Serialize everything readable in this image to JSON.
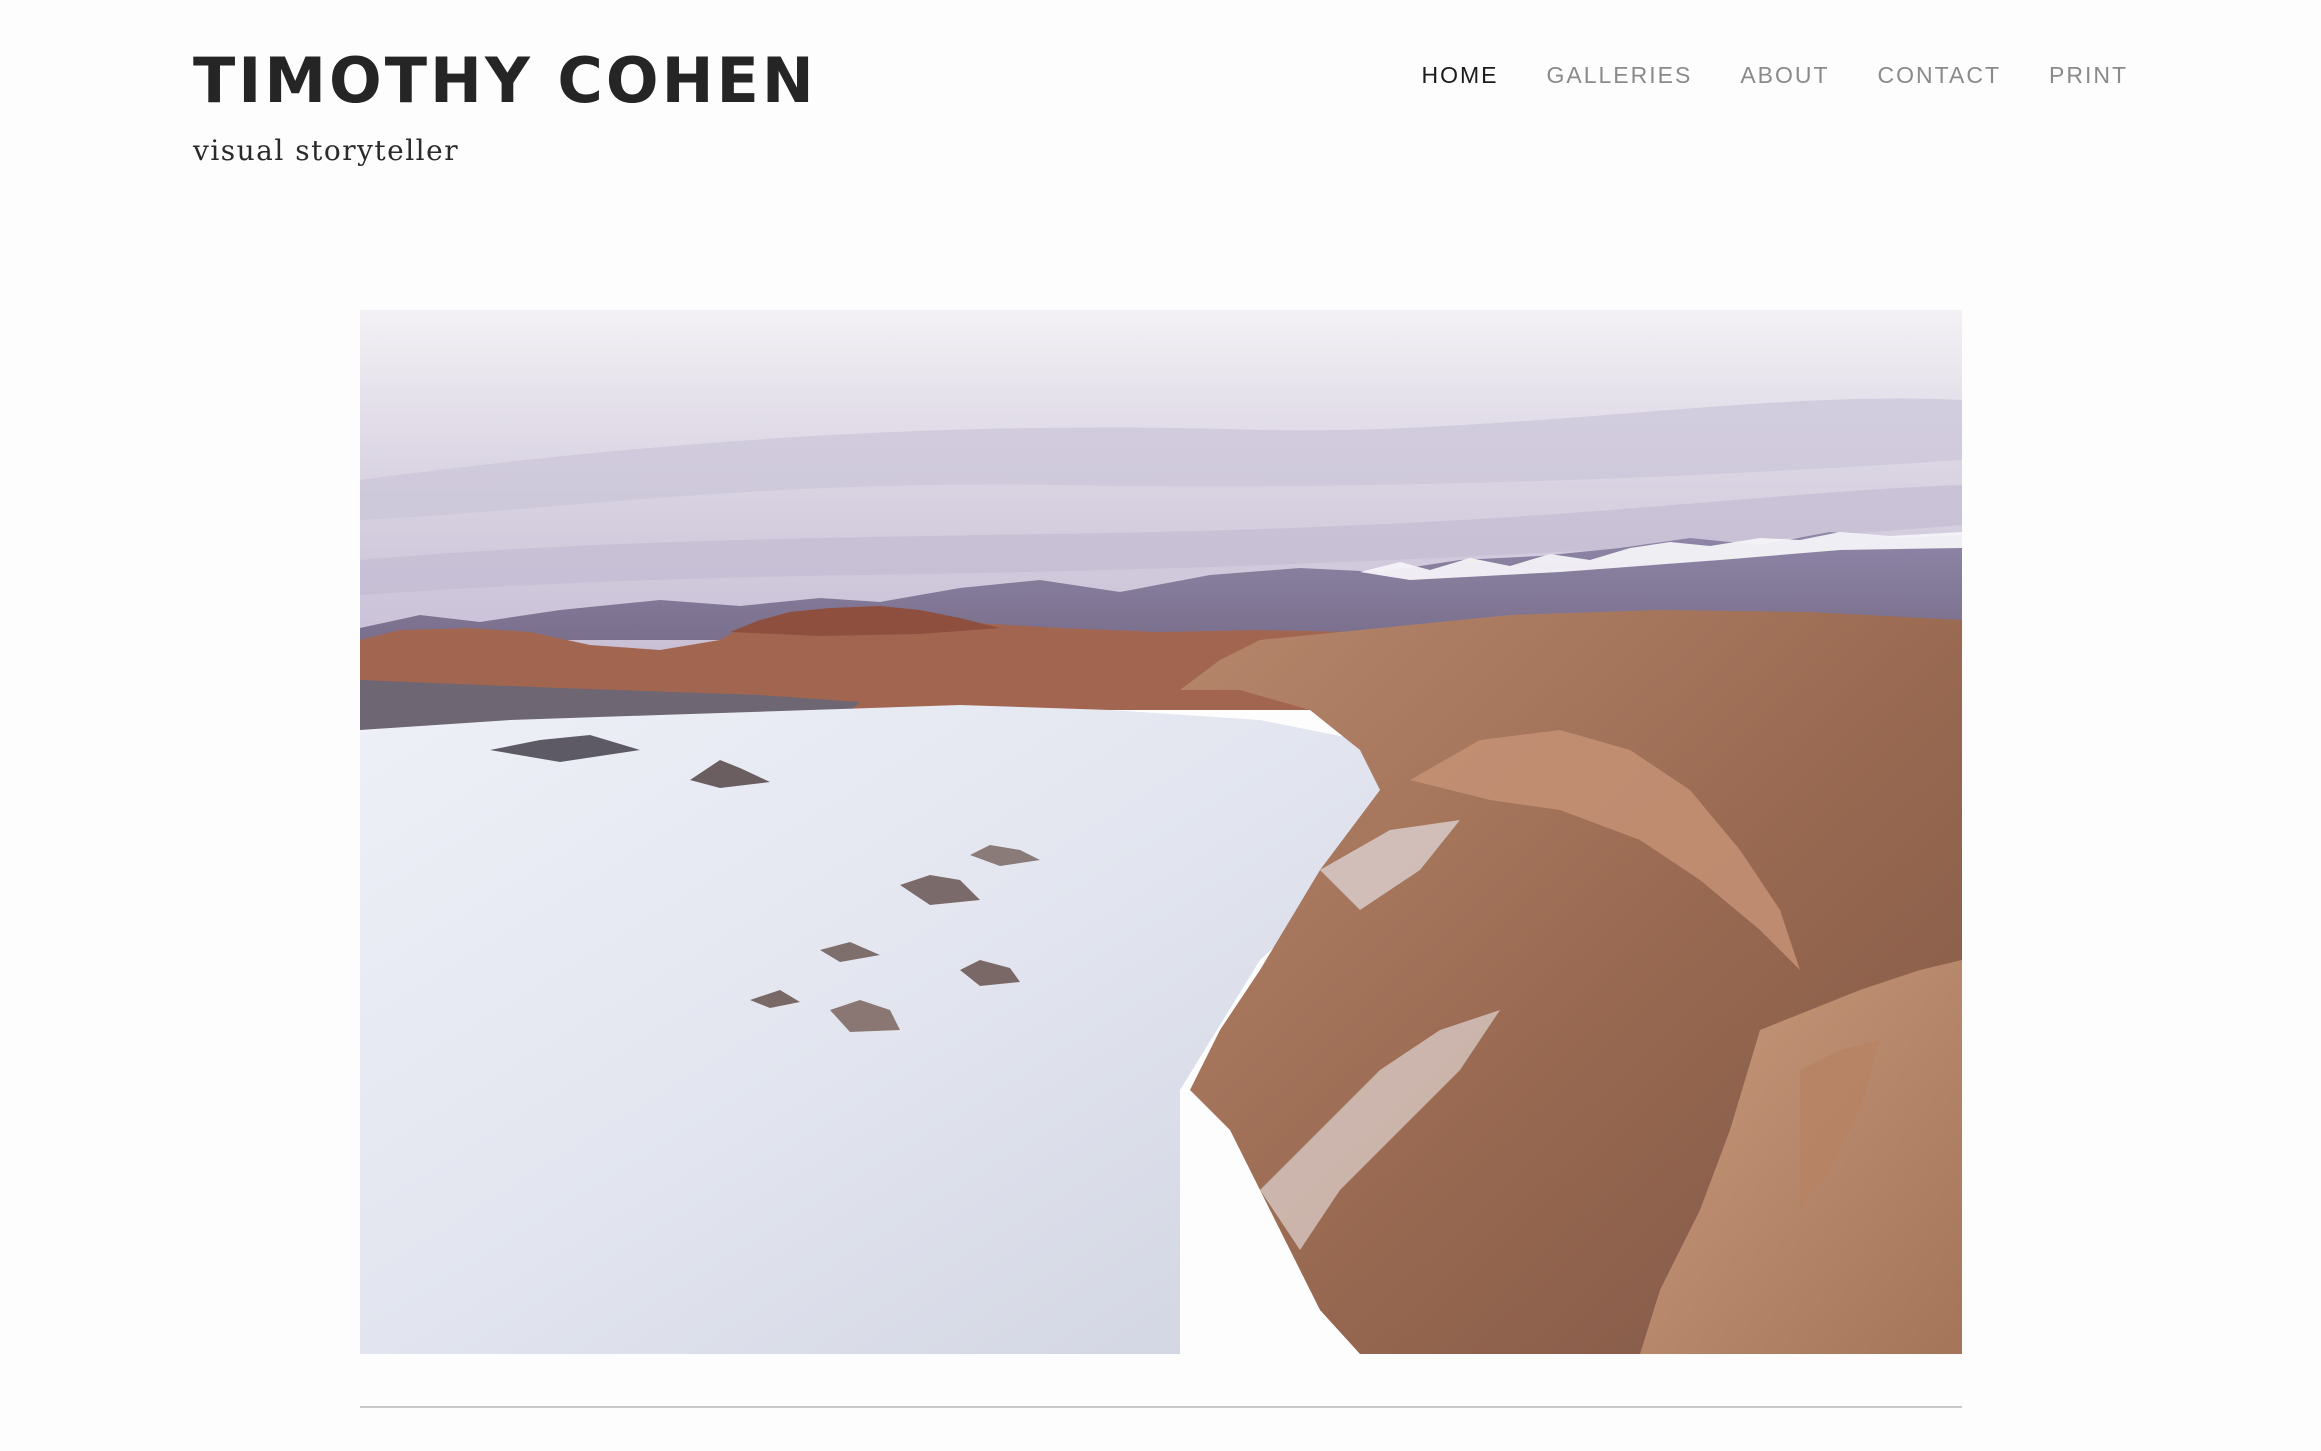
{
  "site": {
    "title": "TIMOTHY COHEN",
    "tagline": "visual storyteller"
  },
  "nav": {
    "items": [
      {
        "label": "HOME",
        "active": true
      },
      {
        "label": "GALLERIES",
        "active": false
      },
      {
        "label": "ABOUT",
        "active": false
      },
      {
        "label": "CONTACT",
        "active": false
      },
      {
        "label": "PRINT",
        "active": false
      }
    ]
  },
  "colors": {
    "background": "#fdfdfd",
    "title_text": "#252525",
    "nav_active": "#1b1b1b",
    "nav_inactive": "#8a8a8a",
    "divider": "#c9c9c9"
  }
}
